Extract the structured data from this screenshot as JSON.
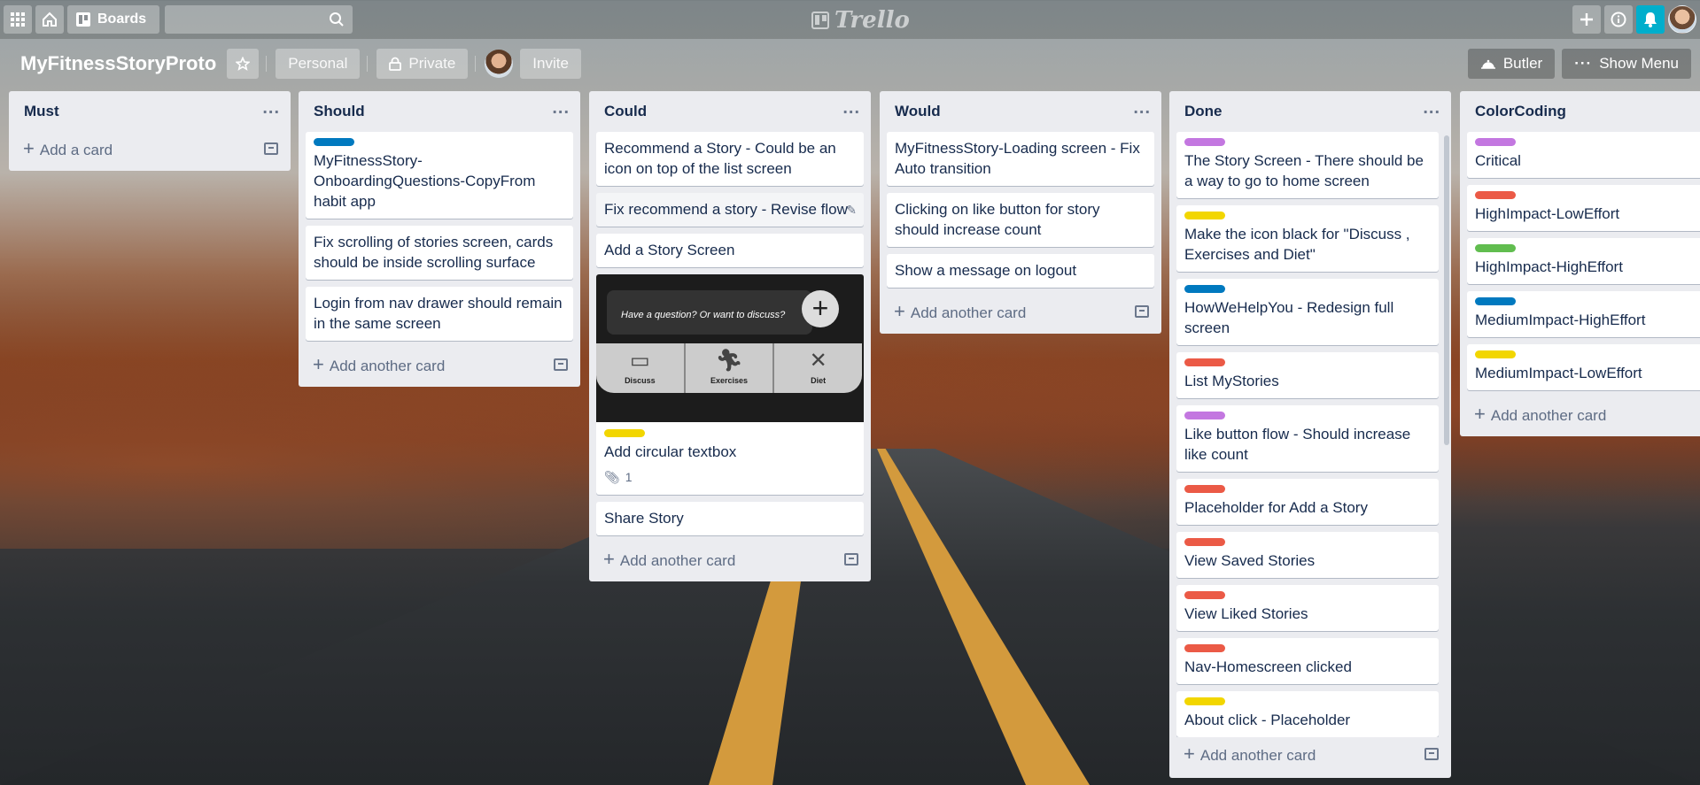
{
  "topbar": {
    "boards_label": "Boards",
    "logo": "Trello",
    "icons": [
      "apps-grid-icon",
      "home-icon",
      "boards-icon",
      "search-icon",
      "plus-icon",
      "info-icon",
      "bell-icon"
    ]
  },
  "board": {
    "title": "MyFitnessStoryProto",
    "visibility_team": "Personal",
    "visibility": "Private",
    "invite": "Invite",
    "butler": "Butler",
    "show_menu": "Show Menu"
  },
  "lists": [
    {
      "title": "Must",
      "add_label": "Add a card",
      "cards": []
    },
    {
      "title": "Should",
      "add_label": "Add another card",
      "cards": [
        {
          "text": "MyFitnessStory-OnboardingQuestions-CopyFrom habit app",
          "label": "#0079bf"
        },
        {
          "text": "Fix scrolling of stories screen, cards should be inside scrolling surface"
        },
        {
          "text": "Login from nav drawer should remain in the same screen"
        }
      ]
    },
    {
      "title": "Could",
      "add_label": "Add another card",
      "cards": [
        {
          "text": "Recommend a Story - Could be an icon on top of the list screen"
        },
        {
          "text": "Fix recommend a story - Revise flow"
        },
        {
          "text": "Add a Story Screen"
        },
        {
          "text": "Add circular textbox",
          "label": "#f2d600",
          "attachments": "1",
          "cover_text": "Have a question? Or want to discuss?",
          "cover_tabs": [
            "Discuss",
            "Exercises",
            "Diet"
          ]
        },
        {
          "text": "Share Story"
        }
      ]
    },
    {
      "title": "Would",
      "add_label": "Add another card",
      "cards": [
        {
          "text": "MyFitnessStory-Loading screen - Fix Auto transition"
        },
        {
          "text": "Clicking on like button for story should increase count"
        },
        {
          "text": "Show a message on logout"
        }
      ]
    },
    {
      "title": "Done",
      "add_label": "Add another card",
      "cards": [
        {
          "text": "The Story Screen - There should be a way to go to home screen",
          "label": "#c377e0"
        },
        {
          "text": "Make the icon black for \"Discuss , Exercises and Diet\"",
          "label": "#f2d600"
        },
        {
          "text": "HowWeHelpYou - Redesign full screen",
          "label": "#0079bf"
        },
        {
          "text": "List MyStories",
          "label": "#eb5a46"
        },
        {
          "text": "Like button flow - Should increase like count",
          "label": "#c377e0"
        },
        {
          "text": "Placeholder for Add a Story",
          "label": "#eb5a46"
        },
        {
          "text": "View Saved Stories",
          "label": "#eb5a46"
        },
        {
          "text": "View Liked Stories",
          "label": "#eb5a46"
        },
        {
          "text": "Nav-Homescreen clicked",
          "label": "#eb5a46"
        },
        {
          "text": "About click - Placeholder",
          "label": "#f2d600"
        }
      ]
    },
    {
      "title": "ColorCoding",
      "add_label": "Add another card",
      "cards": [
        {
          "text": "Critical",
          "label": "#c377e0"
        },
        {
          "text": "HighImpact-LowEffort",
          "label": "#eb5a46"
        },
        {
          "text": "HighImpact-HighEffort",
          "label": "#61bd4f"
        },
        {
          "text": "MediumImpact-HighEffort",
          "label": "#0079bf"
        },
        {
          "text": "MediumImpact-LowEffort",
          "label": "#f2d600"
        }
      ]
    }
  ]
}
